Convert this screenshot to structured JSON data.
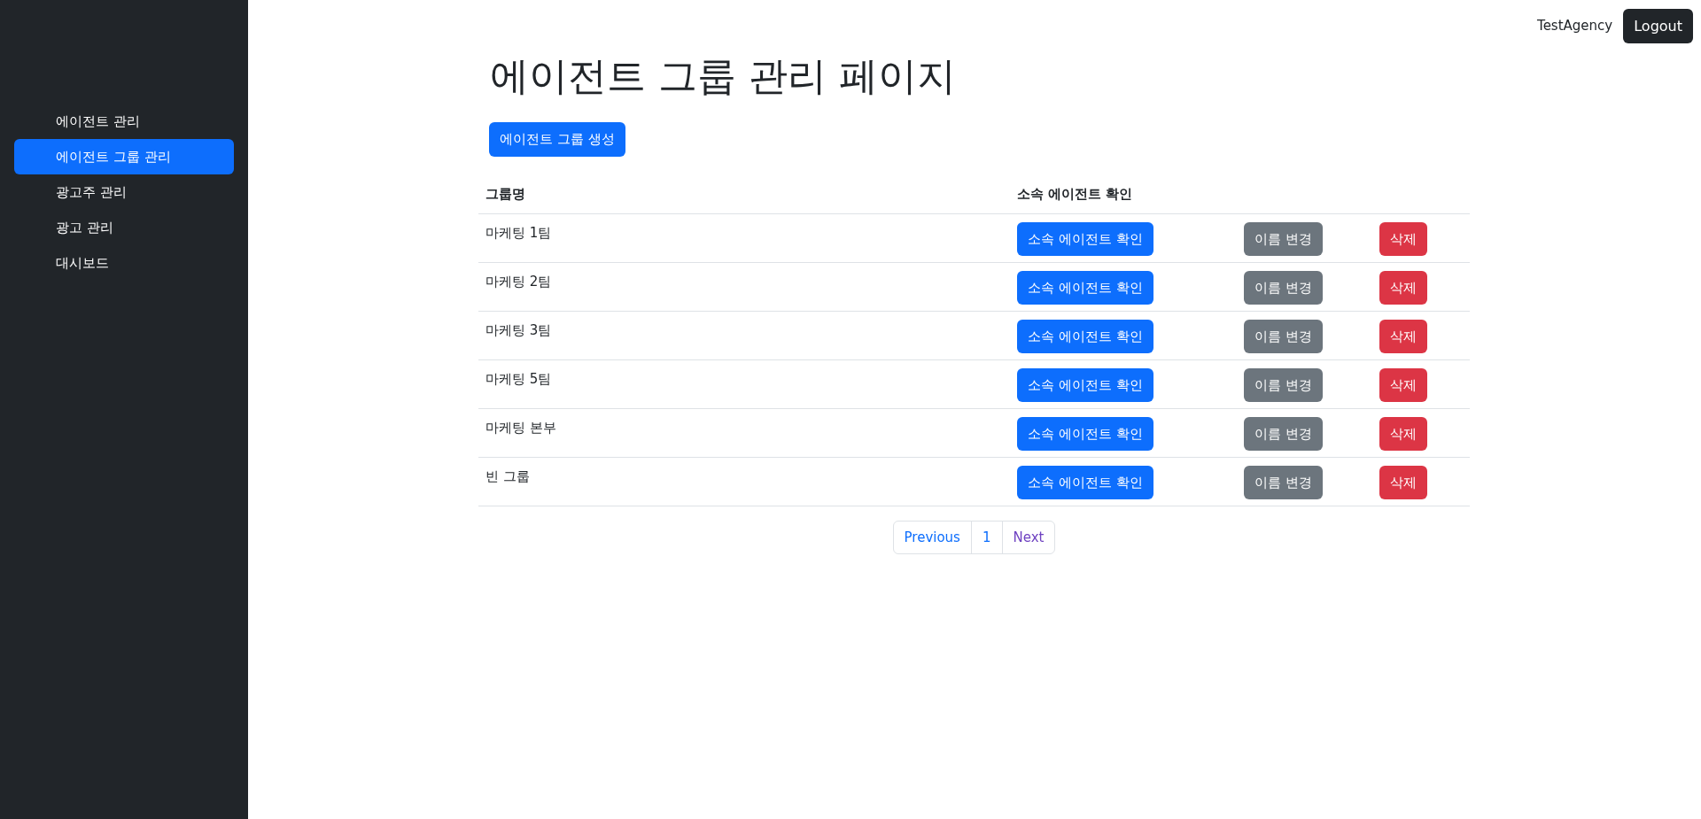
{
  "sidebar": {
    "items": [
      {
        "label": "에이전트 관리",
        "selected": false
      },
      {
        "label": "에이전트 그룹 관리",
        "selected": true
      },
      {
        "label": "광고주 관리",
        "selected": false
      },
      {
        "label": "광고 관리",
        "selected": false
      },
      {
        "label": "대시보드",
        "selected": false
      }
    ]
  },
  "header": {
    "user": "TestAgency",
    "logout": "Logout"
  },
  "page": {
    "title": "에이전트 그룹 관리 페이지",
    "create_button": "에이전트 그룹 생성"
  },
  "table": {
    "columns": [
      "그룹명",
      "소속 에이전트 확인"
    ],
    "rows": [
      {
        "name": "마케팅 1팀",
        "members_button": "소속 에이전트 확인",
        "rename_button": "이름 변경",
        "delete_button": "삭제"
      },
      {
        "name": "마케팅 2팀",
        "members_button": "소속 에이전트 확인",
        "rename_button": "이름 변경",
        "delete_button": "삭제"
      },
      {
        "name": "마케팅 3팀",
        "members_button": "소속 에이전트 확인",
        "rename_button": "이름 변경",
        "delete_button": "삭제"
      },
      {
        "name": "마케팅 5팀",
        "members_button": "소속 에이전트 확인",
        "rename_button": "이름 변경",
        "delete_button": "삭제"
      },
      {
        "name": "마케팅 본부",
        "members_button": "소속 에이전트 확인",
        "rename_button": "이름 변경",
        "delete_button": "삭제"
      },
      {
        "name": "빈 그룹",
        "members_button": "소속 에이전트 확인",
        "rename_button": "이름 변경",
        "delete_button": "삭제"
      }
    ]
  },
  "pagination": [
    {
      "label": "Previous",
      "visited": false
    },
    {
      "label": "1",
      "visited": false
    },
    {
      "label": "Next",
      "visited": true
    }
  ]
}
